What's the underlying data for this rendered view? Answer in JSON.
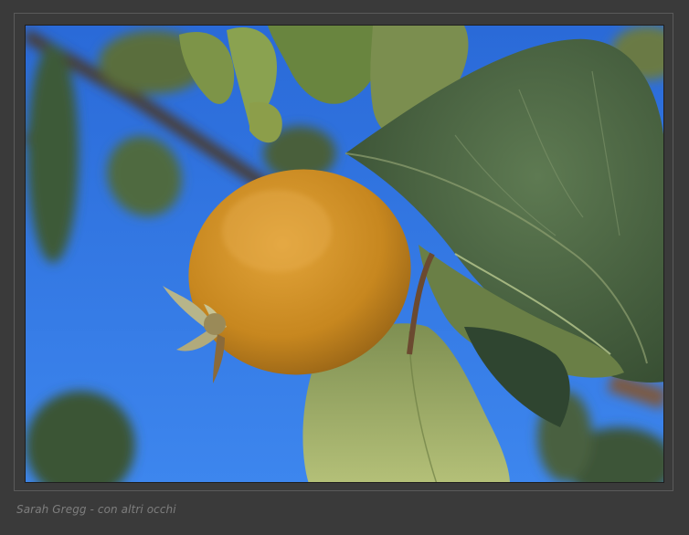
{
  "photo": {
    "subject_icon": "quince-fruit-icon",
    "colors": {
      "frame": "#3a3a3a",
      "sky": "#2f73e0",
      "fruit": "#c98a22",
      "leaf_dark": "#3f5a3a",
      "leaf_light": "#8fa35a",
      "branch": "#4a3a2e"
    }
  },
  "caption": {
    "text": "Sarah Gregg - con altri occhi"
  }
}
